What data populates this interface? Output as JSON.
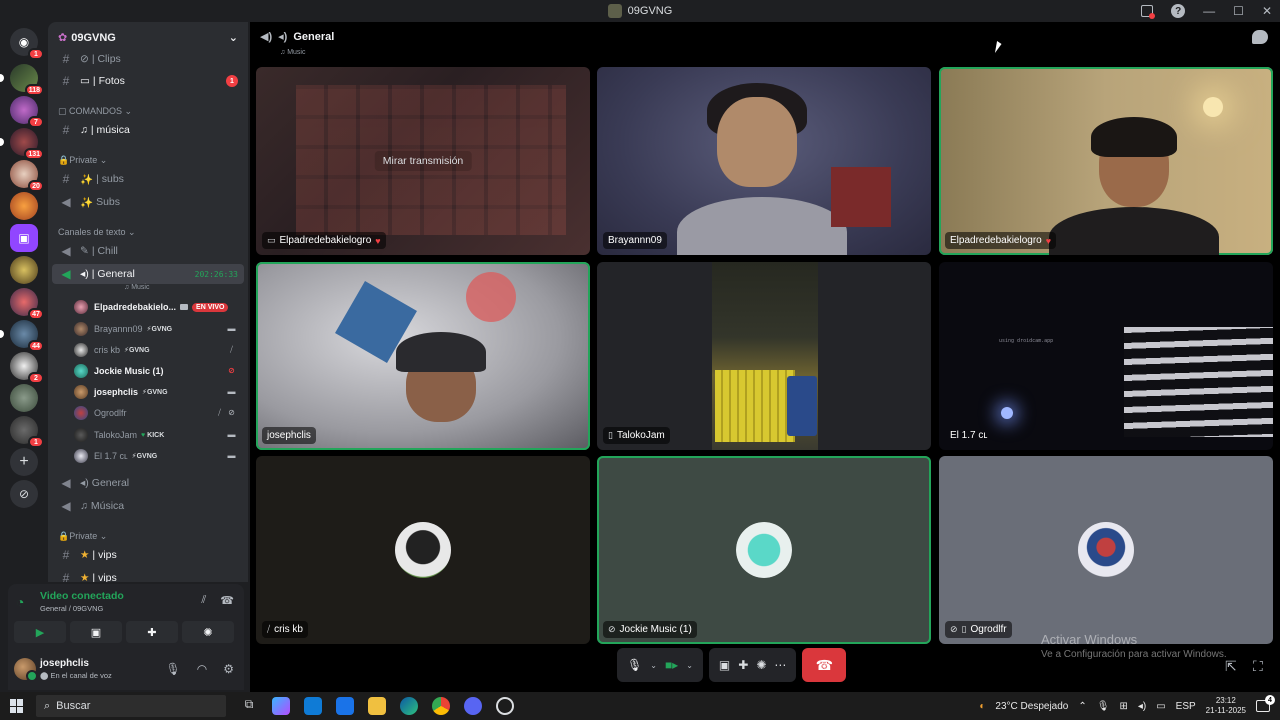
{
  "window": {
    "title": "09GVNG"
  },
  "server": {
    "name": "09GVNG"
  },
  "rail": {
    "badges": [
      "1",
      "118",
      "7",
      "131",
      "20",
      "47",
      "44",
      "2",
      "1"
    ]
  },
  "channels": [
    {
      "id": "clips",
      "icon": "film-icon",
      "label": "| Clips"
    },
    {
      "id": "fotos",
      "icon": "photo-icon",
      "label": "| Fotos",
      "badge": "1"
    },
    {
      "id": "musica",
      "icon": "music-icon",
      "label": "| música"
    },
    {
      "id": "subs-text",
      "icon": "sparkle-icon",
      "label": "| subs"
    },
    {
      "id": "subs-voice",
      "icon": "sparkle-icon",
      "label": "Subs"
    },
    {
      "id": "chill",
      "icon": "mic-icon",
      "label": "| Chill"
    },
    {
      "id": "general",
      "icon": "speaker-icon",
      "label": "| General",
      "time": "202:26:33",
      "sub": "Music"
    },
    {
      "id": "general1",
      "icon": "speaker-icon",
      "label": "General"
    },
    {
      "id": "musica-voice",
      "icon": "music-icon",
      "label": "Música"
    },
    {
      "id": "vips1",
      "icon": "star-icon",
      "label": "| vips"
    },
    {
      "id": "vips2",
      "icon": "star-icon",
      "label": "| vips"
    }
  ],
  "categories": {
    "comandos": "COMANDOS",
    "private1": "Private",
    "canales": "Canales de texto",
    "private2": "Private"
  },
  "voice_users": [
    {
      "name": "Elpadredebakielo...",
      "live": "EN VIVO"
    },
    {
      "name": "Brayannn09",
      "tag": "GVNG"
    },
    {
      "name": "cris kb",
      "tag": "GVNG"
    },
    {
      "name": "Jockie Music (1)"
    },
    {
      "name": "josephclis",
      "tag": "GVNG"
    },
    {
      "name": "Ogrodlfr"
    },
    {
      "name": "TalokoJam",
      "tag": "KICK"
    },
    {
      "name": "El 1.7 ᴄʟ",
      "tag": "GVNG"
    }
  ],
  "voice_panel": {
    "status": "Video conectado",
    "location": "General / 09GVNG"
  },
  "user": {
    "name": "josephclis",
    "status": "En el canal de voz"
  },
  "call": {
    "channel": "General",
    "subtitle": "Music",
    "watch_label": "Mirar transmisión",
    "tiles": [
      {
        "name": "Elpadredebakielogro"
      },
      {
        "name": "Brayannn09"
      },
      {
        "name": "Elpadredebakielogro"
      },
      {
        "name": "josephclis"
      },
      {
        "name": "TalokoJam"
      },
      {
        "name": "El 1.7 ᴄʟ"
      },
      {
        "name": "cris kb"
      },
      {
        "name": "Jockie Music (1)"
      },
      {
        "name": "Ogrodlfr"
      }
    ],
    "watermark": "using droidcam.app"
  },
  "windows_notice": {
    "title": "Activar Windows",
    "body": "Ve a Configuración para activar Windows."
  },
  "taskbar": {
    "search_placeholder": "Buscar",
    "weather": "23°C  Despejado",
    "lang": "ESP",
    "time": "23:12",
    "date": "21-11-2025",
    "notif_count": "4"
  },
  "colors": {
    "accent_green": "#23a55a",
    "danger_red": "#da373c",
    "badge_red": "#f23f43"
  }
}
